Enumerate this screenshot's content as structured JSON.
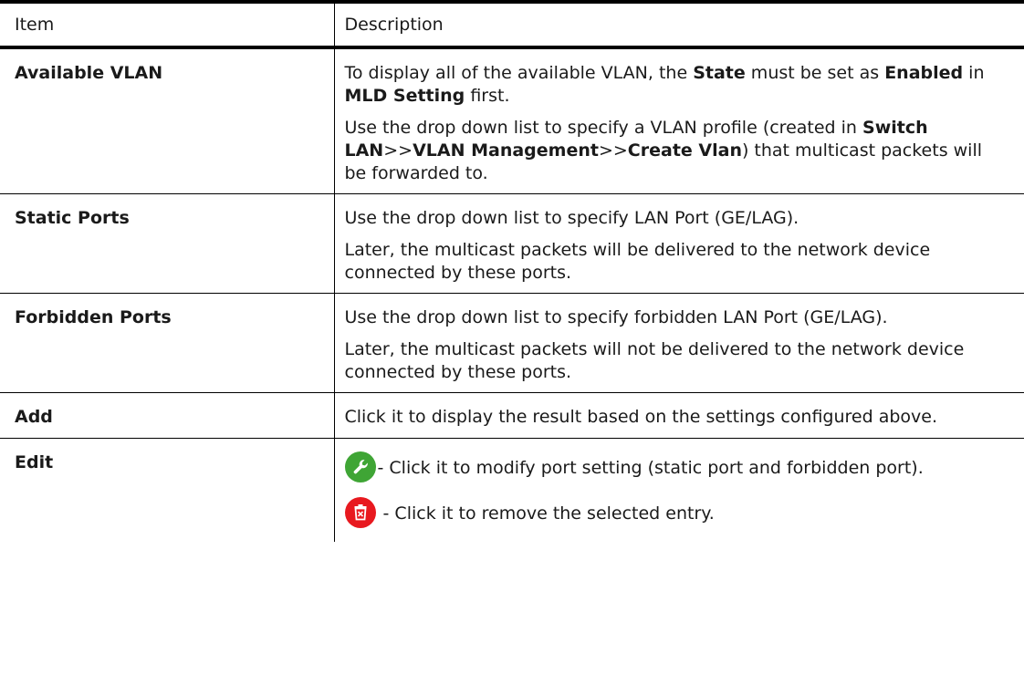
{
  "header": {
    "item": "Item",
    "description": "Description"
  },
  "rows": [
    {
      "item": "Available VLAN",
      "p1": {
        "a": "To display all of the available VLAN, the ",
        "b": "State",
        "c": " must be set as ",
        "d": "Enabled",
        "e": " in ",
        "f": "MLD Setting",
        "g": " first."
      },
      "p2": {
        "a": "Use the drop down list to specify a VLAN profile (created in ",
        "b": "Switch LAN",
        "c": ">>",
        "d": "VLAN Management",
        "e": ">>",
        "f": "Create Vlan",
        "g": ") that multicast packets will be forwarded to."
      }
    },
    {
      "item": "Static Ports",
      "p1": "Use the drop down list to specify LAN Port (GE/LAG).",
      "p2": "Later, the multicast packets will be delivered to the network device connected by these ports."
    },
    {
      "item": "Forbidden Ports",
      "p1": "Use the drop down list to specify forbidden LAN Port (GE/LAG).",
      "p2": "Later, the multicast packets will not be delivered to the network device connected by these ports."
    },
    {
      "item": "Add",
      "p1": "Click it to display the result based on the settings configured above."
    },
    {
      "item": "Edit",
      "edit_text": "- Click it to modify port setting (static port and forbidden port).",
      "delete_text": " - Click it to remove the selected entry.",
      "edit_icon": "wrench-icon",
      "delete_icon": "trash-icon",
      "edit_icon_color": "#3fa535",
      "delete_icon_color": "#e8191f"
    }
  ]
}
